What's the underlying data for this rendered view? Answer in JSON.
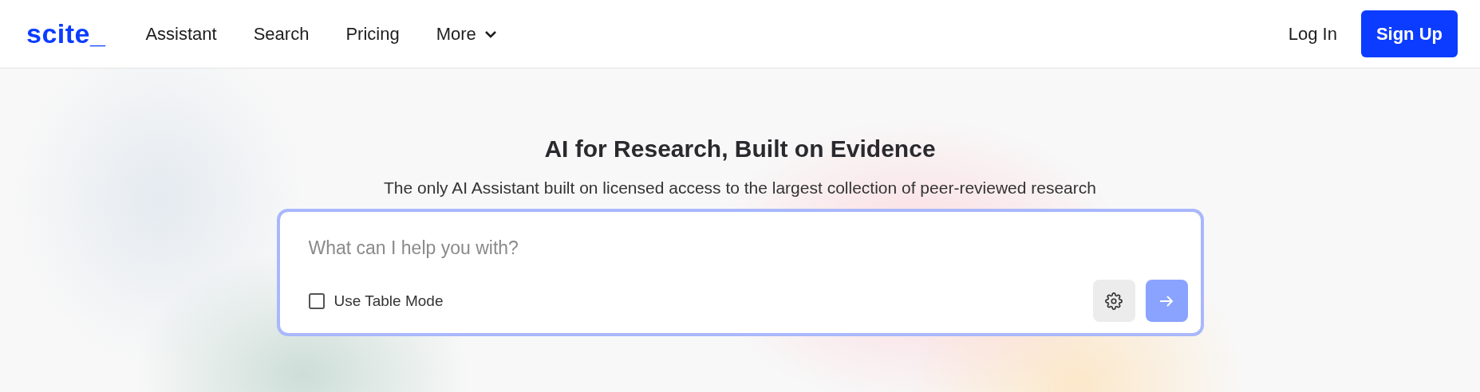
{
  "header": {
    "logo": "scite_",
    "nav": [
      {
        "label": "Assistant",
        "kind": "link"
      },
      {
        "label": "Search",
        "kind": "link"
      },
      {
        "label": "Pricing",
        "kind": "link"
      },
      {
        "label": "More",
        "kind": "menu"
      }
    ],
    "login": "Log In",
    "signup": "Sign Up"
  },
  "hero": {
    "title": "AI for Research, Built on Evidence",
    "subtitle": "The only AI Assistant built on licensed access to the largest collection of peer-reviewed research"
  },
  "prompt": {
    "placeholder": "What can I help you with?",
    "table_mode": {
      "label": "Use Table Mode",
      "checked": false
    }
  }
}
